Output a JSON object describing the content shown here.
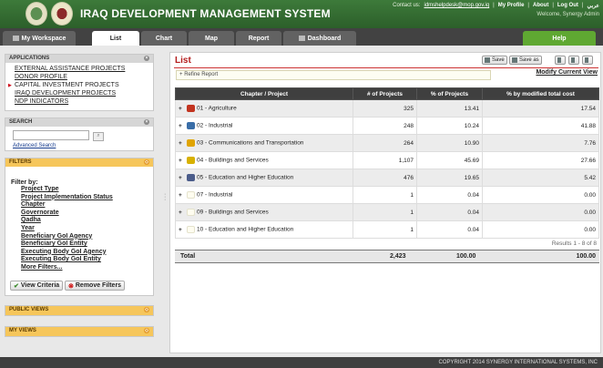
{
  "header": {
    "title": "IRAQ DEVELOPMENT MANAGEMENT SYSTEM",
    "contact_label": "Contact us:",
    "contact_email": "idmshelpdesk@mop.gov.iq",
    "links": [
      "My Profile",
      "About",
      "Log Out",
      "عربي"
    ],
    "welcome": "Welcome, Synergy Admin"
  },
  "tabs": {
    "workspace": "My Workspace",
    "list": "List",
    "chart": "Chart",
    "map": "Map",
    "report": "Report",
    "dashboard": "Dashboard",
    "help": "Help"
  },
  "sidebar": {
    "applications": {
      "title": "APPLICATIONS",
      "items": [
        "EXTERNAL ASSISTANCE PROJECTS",
        "DONOR PROFILE",
        "CAPITAL INVESTMENT PROJECTS",
        "IRAQ DEVELOPMENT PROJECTS",
        "NDP INDICATORS"
      ]
    },
    "search": {
      "title": "SEARCH",
      "advanced": "Advanced Search"
    },
    "filters": {
      "title": "FILTERS",
      "filter_by": "Filter by:",
      "items": [
        "Project Type",
        "Project Implementation Status",
        "Chapter",
        "Governorate",
        "Qadha",
        "Year",
        "Beneficiary GoI Agency",
        "Beneficiary GoI Entity",
        "Executing Body GoI Agency",
        "Executing Body GoI Entity",
        "More Filters..."
      ],
      "view_criteria": "View Criteria",
      "remove_filters": "Remove Filters"
    },
    "public_views": "PUBLIC VIEWS",
    "my_views": "MY VIEWS"
  },
  "main": {
    "title": "List",
    "save": "Save",
    "save_as": "Save as",
    "modify": "Modify Current View",
    "refine": "Refine Report",
    "columns": [
      "Chapter / Project",
      "# of Projects",
      "% of Projects",
      "% by modified total cost"
    ],
    "rows": [
      {
        "label": "01 - Agriculture",
        "projects": "325",
        "pct": "13.41",
        "cost": "17.54",
        "icon": "#c2331f"
      },
      {
        "label": "02 - Industrial",
        "projects": "248",
        "pct": "10.24",
        "cost": "41.88",
        "icon": "#3a6ea8"
      },
      {
        "label": "03 - Communications and Transportation",
        "projects": "264",
        "pct": "10.90",
        "cost": "7.76",
        "icon": "#e0a400"
      },
      {
        "label": "04 - Buildings and Services",
        "projects": "1,107",
        "pct": "45.69",
        "cost": "27.66",
        "icon": "#d8b100"
      },
      {
        "label": "05 - Education and Higher Education",
        "projects": "476",
        "pct": "19.65",
        "cost": "5.42",
        "icon": "#4b5c8a"
      },
      {
        "label": "07 - Industrial",
        "projects": "1",
        "pct": "0.04",
        "cost": "0.00",
        "icon": ""
      },
      {
        "label": "09 - Buildings and Services",
        "projects": "1",
        "pct": "0.04",
        "cost": "0.00",
        "icon": ""
      },
      {
        "label": "10 - Education and Higher Education",
        "projects": "1",
        "pct": "0.04",
        "cost": "0.00",
        "icon": ""
      }
    ],
    "results": "Results 1 - 8 of 8",
    "total": {
      "label": "Total",
      "projects": "2,423",
      "pct": "100.00",
      "cost": "100.00"
    }
  },
  "footer": "COPYRIGHT 2014 SYNERGY INTERNATIONAL SYSTEMS, INC"
}
